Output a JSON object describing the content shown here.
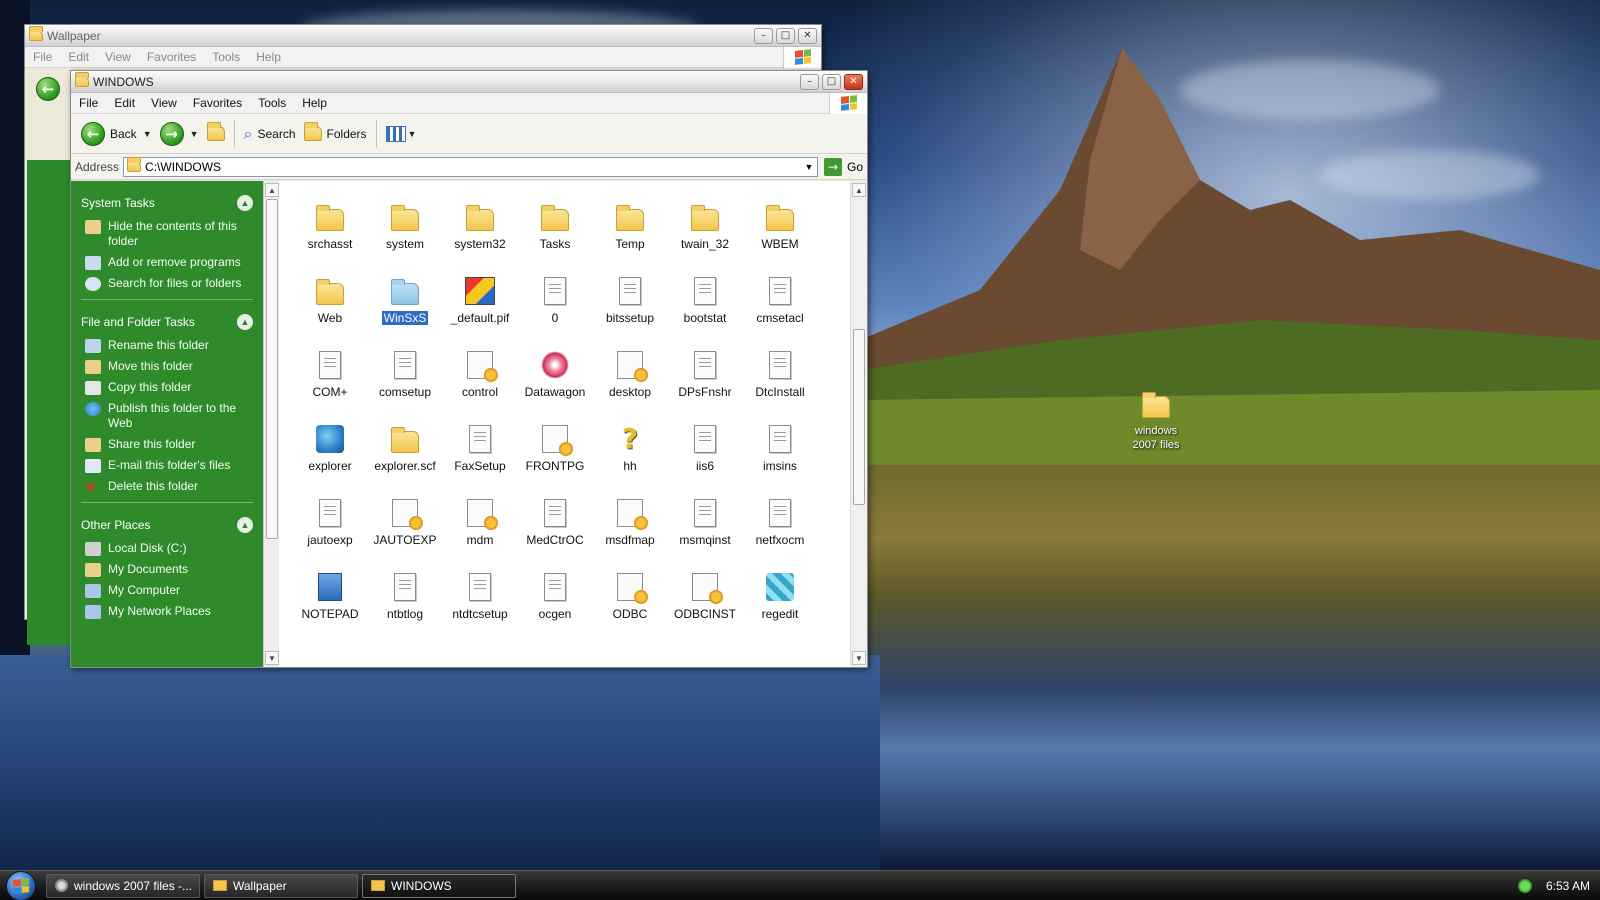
{
  "desktop": {
    "icon_label": "windows\n2007 files"
  },
  "win_back": {
    "title": "Wallpaper",
    "menu": [
      "File",
      "Edit",
      "View",
      "Favorites",
      "Tools",
      "Help"
    ]
  },
  "win_front": {
    "title": "WINDOWS",
    "menu": [
      "File",
      "Edit",
      "View",
      "Favorites",
      "Tools",
      "Help"
    ],
    "toolbar": {
      "back": "Back",
      "search": "Search",
      "folders": "Folders"
    },
    "address": {
      "label": "Address",
      "value": "C:\\WINDOWS",
      "go": "Go"
    },
    "taskpane": {
      "system_tasks": {
        "title": "System Tasks",
        "items": [
          "Hide the contents of this folder",
          "Add or remove programs",
          "Search for files or folders"
        ]
      },
      "file_folder_tasks": {
        "title": "File and Folder Tasks",
        "items": [
          "Rename this folder",
          "Move this folder",
          "Copy this folder",
          "Publish this folder to the Web",
          "Share this folder",
          "E-mail this folder's files",
          "Delete this folder"
        ]
      },
      "other_places": {
        "title": "Other Places",
        "items": [
          "Local Disk (C:)",
          "My Documents",
          "My Computer",
          "My Network Places"
        ]
      }
    },
    "files": [
      {
        "name": "srchasst",
        "type": "folder"
      },
      {
        "name": "system",
        "type": "folder"
      },
      {
        "name": "system32",
        "type": "folder"
      },
      {
        "name": "Tasks",
        "type": "folder"
      },
      {
        "name": "Temp",
        "type": "folder"
      },
      {
        "name": "twain_32",
        "type": "folder"
      },
      {
        "name": "WBEM",
        "type": "folder"
      },
      {
        "name": "Web",
        "type": "folder"
      },
      {
        "name": "WinSxS",
        "type": "folder",
        "selected": true
      },
      {
        "name": "_default.pif",
        "type": "ms"
      },
      {
        "name": "0",
        "type": "doc"
      },
      {
        "name": "bitssetup",
        "type": "doc"
      },
      {
        "name": "bootstat",
        "type": "doc"
      },
      {
        "name": "cmsetacl",
        "type": "doc"
      },
      {
        "name": "COM+",
        "type": "doc"
      },
      {
        "name": "comsetup",
        "type": "doc"
      },
      {
        "name": "control",
        "type": "app"
      },
      {
        "name": "Datawagon",
        "type": "pink"
      },
      {
        "name": "desktop",
        "type": "app"
      },
      {
        "name": "DPsFnshr",
        "type": "doc"
      },
      {
        "name": "DtcInstall",
        "type": "doc"
      },
      {
        "name": "explorer",
        "type": "special"
      },
      {
        "name": "explorer.scf",
        "type": "folder"
      },
      {
        "name": "FaxSetup",
        "type": "doc"
      },
      {
        "name": "FRONTPG",
        "type": "app"
      },
      {
        "name": "hh",
        "type": "help"
      },
      {
        "name": "iis6",
        "type": "doc"
      },
      {
        "name": "imsins",
        "type": "doc"
      },
      {
        "name": "jautoexp",
        "type": "doc"
      },
      {
        "name": "JAUTOEXP",
        "type": "app"
      },
      {
        "name": "mdm",
        "type": "app"
      },
      {
        "name": "MedCtrOC",
        "type": "doc"
      },
      {
        "name": "msdfmap",
        "type": "app"
      },
      {
        "name": "msmqinst",
        "type": "doc"
      },
      {
        "name": "netfxocm",
        "type": "doc"
      },
      {
        "name": "NOTEPAD",
        "type": "notepad"
      },
      {
        "name": "ntbtlog",
        "type": "doc"
      },
      {
        "name": "ntdtcsetup",
        "type": "doc"
      },
      {
        "name": "ocgen",
        "type": "doc"
      },
      {
        "name": "ODBC",
        "type": "app"
      },
      {
        "name": "ODBCINST",
        "type": "app"
      },
      {
        "name": "regedit",
        "type": "regedit"
      }
    ]
  },
  "taskbar": {
    "buttons": [
      "windows 2007 files -...",
      "Wallpaper",
      "WINDOWS"
    ],
    "clock": "6:53 AM"
  }
}
